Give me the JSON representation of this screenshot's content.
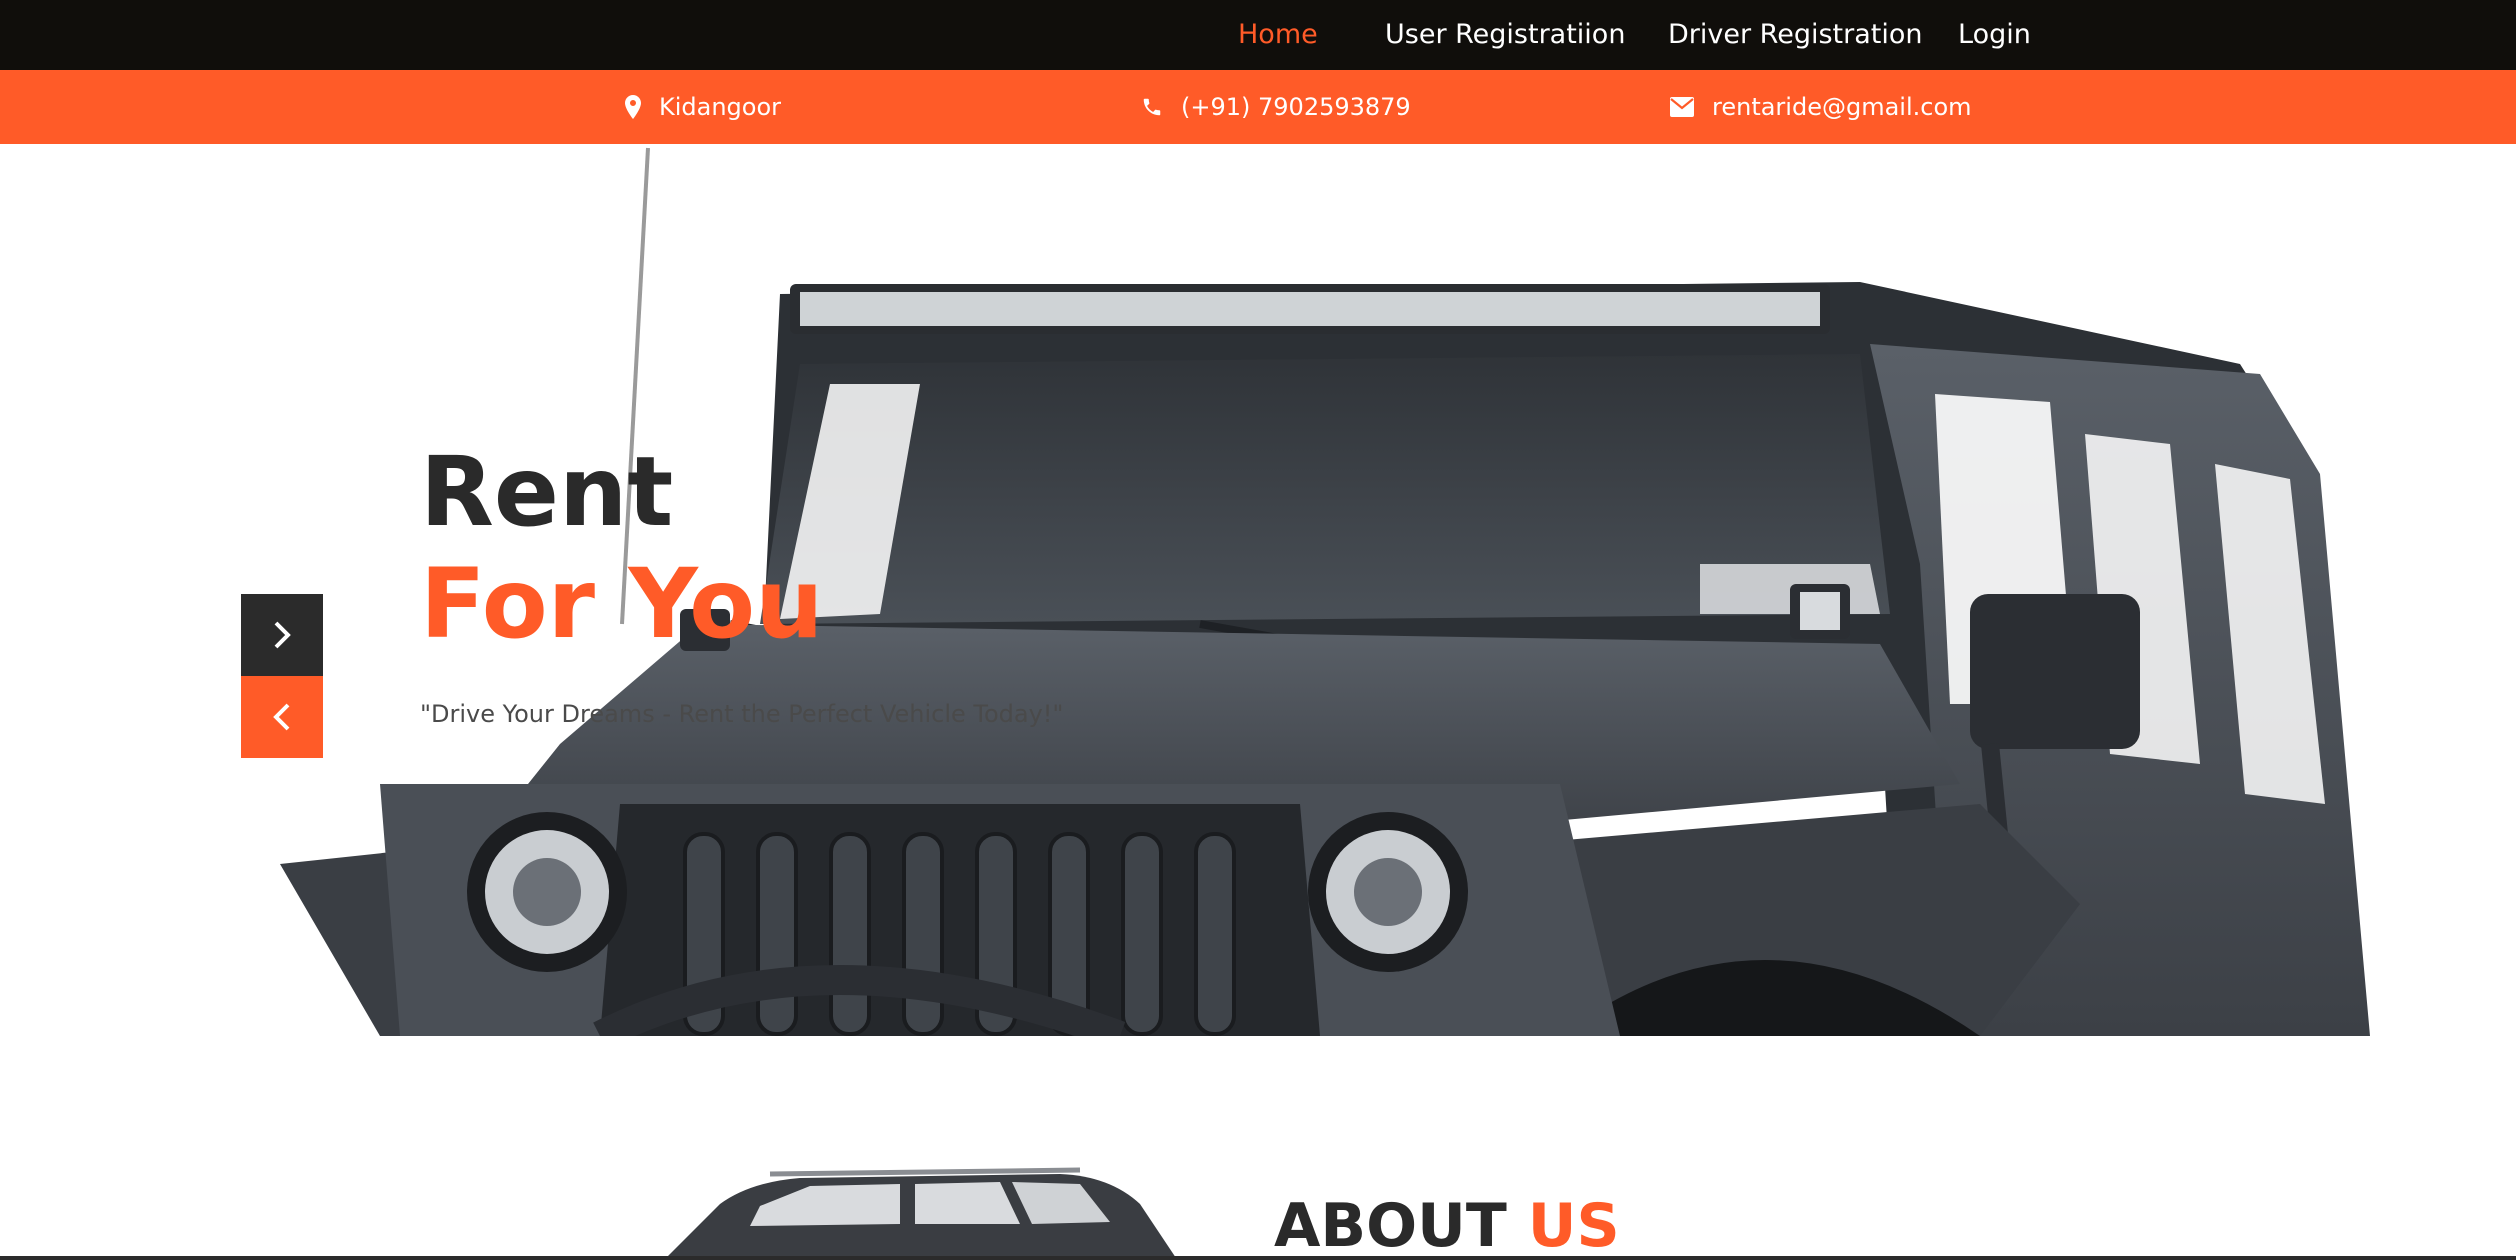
{
  "nav": {
    "home": "Home",
    "user_registration": "User Registratiion",
    "driver_registration": "Driver Registration",
    "login": "Login"
  },
  "contact": {
    "location": "Kidangoor",
    "phone": "(+91) 7902593879",
    "email": "rentaride@gmail.com"
  },
  "hero": {
    "title_line1": "Rent",
    "title_line2": "For You",
    "tagline": "\"Drive Your Dreams - Rent the Perfect Vehicle Today!\""
  },
  "about": {
    "title_part1": "ABOUT",
    "title_part2": "US"
  },
  "icons": {
    "location": "map-marker-icon",
    "phone": "phone-icon",
    "email": "envelope-icon",
    "next": "chevron-right-icon",
    "prev": "chevron-left-icon"
  },
  "colors": {
    "accent": "#ff5b28",
    "navbar": "#100e0b",
    "dark_text": "#2a2a2a"
  }
}
